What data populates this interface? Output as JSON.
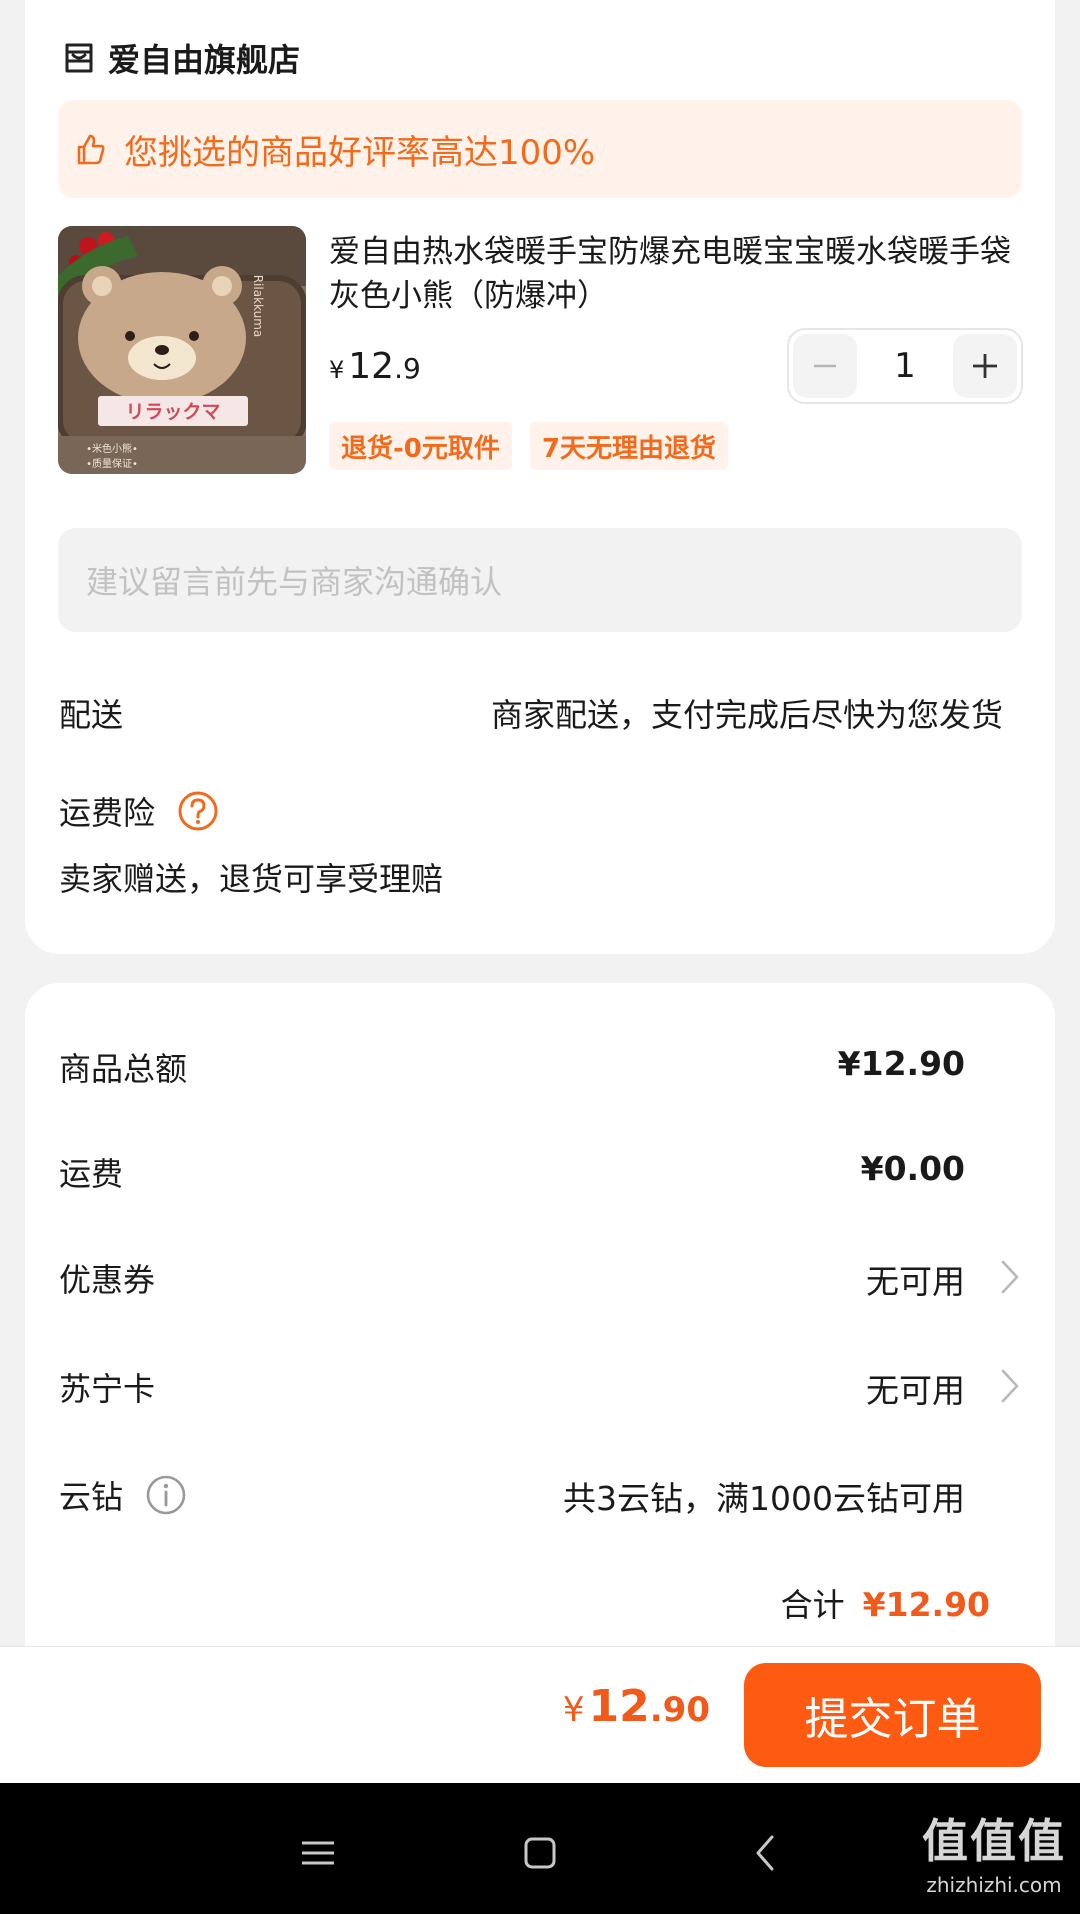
{
  "store": {
    "name": "爱自由旗舰店",
    "icon": "store-icon"
  },
  "rating_banner": {
    "text": "您挑选的商品好评率高达100%",
    "icon": "thumbs-up-icon"
  },
  "product": {
    "title": "爱自由热水袋暖手宝防爆充电暖宝宝暖水袋暖手袋 灰色小熊（防爆冲）",
    "price_symbol": "¥",
    "price_int": "12",
    "price_dec": ".9",
    "quantity": "1",
    "tags": [
      "退货-0元取件",
      "7天无理由退货"
    ],
    "image_text": {
      "brand_small": "Rilakkuma",
      "banner": "リラックマ",
      "caption1": "•米色小熊•",
      "caption2": "•质量保证•"
    }
  },
  "note": {
    "placeholder": "建议留言前先与商家沟通确认"
  },
  "shipping": {
    "label": "配送",
    "value": "商家配送，支付完成后尽快为您发货"
  },
  "insurance": {
    "label": "运费险",
    "desc": "卖家赠送，退货可享受理赔",
    "icon": "question-circle-icon"
  },
  "summary": {
    "goods_total": {
      "label": "商品总额",
      "value": "¥12.90"
    },
    "freight": {
      "label": "运费",
      "value": "¥0.00"
    },
    "coupon": {
      "label": "优惠券",
      "value": "无可用"
    },
    "suning_card": {
      "label": "苏宁卡",
      "value": "无可用"
    },
    "cloud_diamond": {
      "label": "云钻",
      "value": "共3云钻，满1000云钻可用",
      "icon": "info-circle-icon"
    },
    "total": {
      "label": "合计",
      "value": "¥12.90"
    }
  },
  "bottom_bar": {
    "price_symbol": "¥",
    "price_int": "12",
    "price_dec": ".90",
    "submit_label": "提交订单"
  },
  "watermark": {
    "big": "值值值",
    "small": "zhizhizhi.com"
  },
  "colors": {
    "accent": "#fd5a12",
    "orange_text": "#f26a1b",
    "banner_bg": "#fff2ea"
  }
}
